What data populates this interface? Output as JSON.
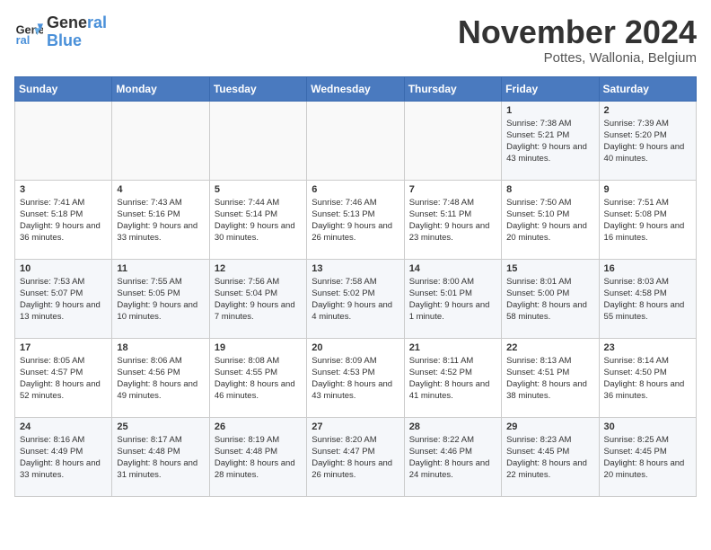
{
  "logo": {
    "line1": "General",
    "line2": "Blue"
  },
  "title": "November 2024",
  "location": "Pottes, Wallonia, Belgium",
  "weekdays": [
    "Sunday",
    "Monday",
    "Tuesday",
    "Wednesday",
    "Thursday",
    "Friday",
    "Saturday"
  ],
  "weeks": [
    [
      {
        "day": "",
        "info": ""
      },
      {
        "day": "",
        "info": ""
      },
      {
        "day": "",
        "info": ""
      },
      {
        "day": "",
        "info": ""
      },
      {
        "day": "",
        "info": ""
      },
      {
        "day": "1",
        "info": "Sunrise: 7:38 AM\nSunset: 5:21 PM\nDaylight: 9 hours and 43 minutes."
      },
      {
        "day": "2",
        "info": "Sunrise: 7:39 AM\nSunset: 5:20 PM\nDaylight: 9 hours and 40 minutes."
      }
    ],
    [
      {
        "day": "3",
        "info": "Sunrise: 7:41 AM\nSunset: 5:18 PM\nDaylight: 9 hours and 36 minutes."
      },
      {
        "day": "4",
        "info": "Sunrise: 7:43 AM\nSunset: 5:16 PM\nDaylight: 9 hours and 33 minutes."
      },
      {
        "day": "5",
        "info": "Sunrise: 7:44 AM\nSunset: 5:14 PM\nDaylight: 9 hours and 30 minutes."
      },
      {
        "day": "6",
        "info": "Sunrise: 7:46 AM\nSunset: 5:13 PM\nDaylight: 9 hours and 26 minutes."
      },
      {
        "day": "7",
        "info": "Sunrise: 7:48 AM\nSunset: 5:11 PM\nDaylight: 9 hours and 23 minutes."
      },
      {
        "day": "8",
        "info": "Sunrise: 7:50 AM\nSunset: 5:10 PM\nDaylight: 9 hours and 20 minutes."
      },
      {
        "day": "9",
        "info": "Sunrise: 7:51 AM\nSunset: 5:08 PM\nDaylight: 9 hours and 16 minutes."
      }
    ],
    [
      {
        "day": "10",
        "info": "Sunrise: 7:53 AM\nSunset: 5:07 PM\nDaylight: 9 hours and 13 minutes."
      },
      {
        "day": "11",
        "info": "Sunrise: 7:55 AM\nSunset: 5:05 PM\nDaylight: 9 hours and 10 minutes."
      },
      {
        "day": "12",
        "info": "Sunrise: 7:56 AM\nSunset: 5:04 PM\nDaylight: 9 hours and 7 minutes."
      },
      {
        "day": "13",
        "info": "Sunrise: 7:58 AM\nSunset: 5:02 PM\nDaylight: 9 hours and 4 minutes."
      },
      {
        "day": "14",
        "info": "Sunrise: 8:00 AM\nSunset: 5:01 PM\nDaylight: 9 hours and 1 minute."
      },
      {
        "day": "15",
        "info": "Sunrise: 8:01 AM\nSunset: 5:00 PM\nDaylight: 8 hours and 58 minutes."
      },
      {
        "day": "16",
        "info": "Sunrise: 8:03 AM\nSunset: 4:58 PM\nDaylight: 8 hours and 55 minutes."
      }
    ],
    [
      {
        "day": "17",
        "info": "Sunrise: 8:05 AM\nSunset: 4:57 PM\nDaylight: 8 hours and 52 minutes."
      },
      {
        "day": "18",
        "info": "Sunrise: 8:06 AM\nSunset: 4:56 PM\nDaylight: 8 hours and 49 minutes."
      },
      {
        "day": "19",
        "info": "Sunrise: 8:08 AM\nSunset: 4:55 PM\nDaylight: 8 hours and 46 minutes."
      },
      {
        "day": "20",
        "info": "Sunrise: 8:09 AM\nSunset: 4:53 PM\nDaylight: 8 hours and 43 minutes."
      },
      {
        "day": "21",
        "info": "Sunrise: 8:11 AM\nSunset: 4:52 PM\nDaylight: 8 hours and 41 minutes."
      },
      {
        "day": "22",
        "info": "Sunrise: 8:13 AM\nSunset: 4:51 PM\nDaylight: 8 hours and 38 minutes."
      },
      {
        "day": "23",
        "info": "Sunrise: 8:14 AM\nSunset: 4:50 PM\nDaylight: 8 hours and 36 minutes."
      }
    ],
    [
      {
        "day": "24",
        "info": "Sunrise: 8:16 AM\nSunset: 4:49 PM\nDaylight: 8 hours and 33 minutes."
      },
      {
        "day": "25",
        "info": "Sunrise: 8:17 AM\nSunset: 4:48 PM\nDaylight: 8 hours and 31 minutes."
      },
      {
        "day": "26",
        "info": "Sunrise: 8:19 AM\nSunset: 4:48 PM\nDaylight: 8 hours and 28 minutes."
      },
      {
        "day": "27",
        "info": "Sunrise: 8:20 AM\nSunset: 4:47 PM\nDaylight: 8 hours and 26 minutes."
      },
      {
        "day": "28",
        "info": "Sunrise: 8:22 AM\nSunset: 4:46 PM\nDaylight: 8 hours and 24 minutes."
      },
      {
        "day": "29",
        "info": "Sunrise: 8:23 AM\nSunset: 4:45 PM\nDaylight: 8 hours and 22 minutes."
      },
      {
        "day": "30",
        "info": "Sunrise: 8:25 AM\nSunset: 4:45 PM\nDaylight: 8 hours and 20 minutes."
      }
    ]
  ]
}
